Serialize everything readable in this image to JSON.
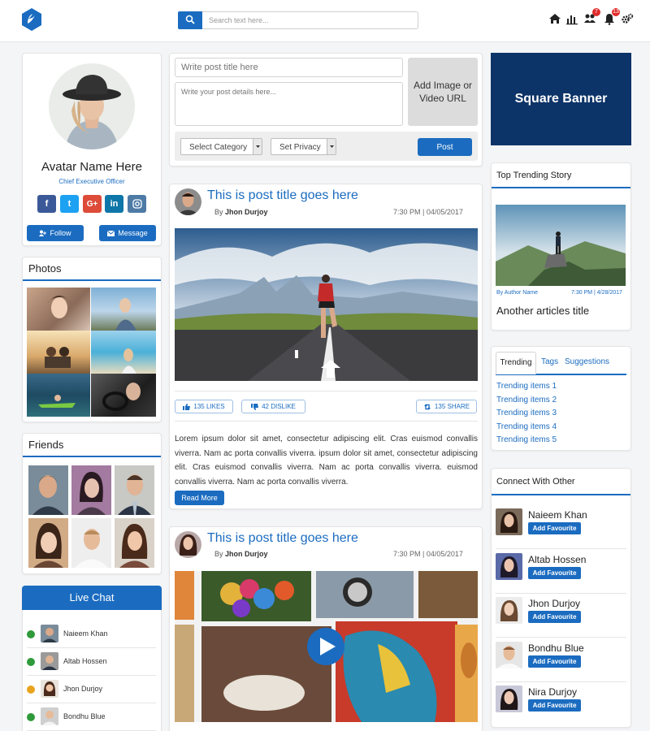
{
  "header": {
    "search_placeholder": "Search text here...",
    "badges": {
      "friends": "7",
      "notifications": "13"
    }
  },
  "profile": {
    "name": "Avatar Name Here",
    "role": "Chief Executive Officer",
    "social": [
      "f",
      "t",
      "G+",
      "in",
      "ig"
    ],
    "follow_label": "Follow",
    "message_label": "Message"
  },
  "photos": {
    "title": "Photos"
  },
  "friends": {
    "title": "Friends"
  },
  "live_chat": {
    "title": "Live Chat",
    "items": [
      {
        "name": "Naieem Khan",
        "status": "online"
      },
      {
        "name": "Altab Hossen",
        "status": "online"
      },
      {
        "name": "Jhon Durjoy",
        "status": "away"
      },
      {
        "name": "Bondhu Blue",
        "status": "online"
      }
    ]
  },
  "composer": {
    "title_placeholder": "Write post title here",
    "details_placeholder": "Write your post details here...",
    "add_media_label": "Add Image or Video URL",
    "category_label": "Select Category",
    "privacy_label": "Set Privacy",
    "post_label": "Post"
  },
  "posts": [
    {
      "title": "This is post title goes here",
      "by_prefix": "By",
      "author": "Jhon Durjoy",
      "time": "7:30 PM | 04/05/2017",
      "likes": "135 LIKES",
      "dislikes": "42 DISLIKE",
      "shares": "135 SHARE",
      "body": "Lorem ipsum dolor sit amet, consectetur adipiscing elit. Cras euismod convallis viverra. Nam ac porta convallis viverra. ipsum dolor sit amet, consectetur adipiscing elit. Cras euismod convallis viverra. Nam ac porta convallis viverra. euismod convallis viverra. Nam ac porta convallis viverra.",
      "read_more": "Read More"
    },
    {
      "title": "This is post title goes here",
      "by_prefix": "By",
      "author": "Jhon Durjoy",
      "time": "7:30 PM | 04/05/2017"
    }
  ],
  "banner": {
    "label": "Square Banner"
  },
  "trending_story": {
    "title": "Top Trending Story",
    "author": "By Author Name",
    "time": "7:30 PM | 4/28/2017",
    "article_title": "Another articles title"
  },
  "trending_tabs": {
    "tabs": [
      "Trending",
      "Tags",
      "Suggestions"
    ],
    "items": [
      "Trending items 1",
      "Trending items 2",
      "Trending items 3",
      "Trending items 4",
      "Trending items 5"
    ]
  },
  "connect": {
    "title": "Connect With Other",
    "add_label": "Add Favourite",
    "people": [
      "Naieem Khan",
      "Altab Hossen",
      "Jhon Durjoy",
      "Bondhu Blue",
      "Nira Durjoy"
    ]
  },
  "colors": {
    "accent": "#1b6cc0",
    "banner": "#0d3468",
    "online": "#2e9a3a",
    "away": "#e8a41f",
    "badge": "#e02b2b"
  }
}
